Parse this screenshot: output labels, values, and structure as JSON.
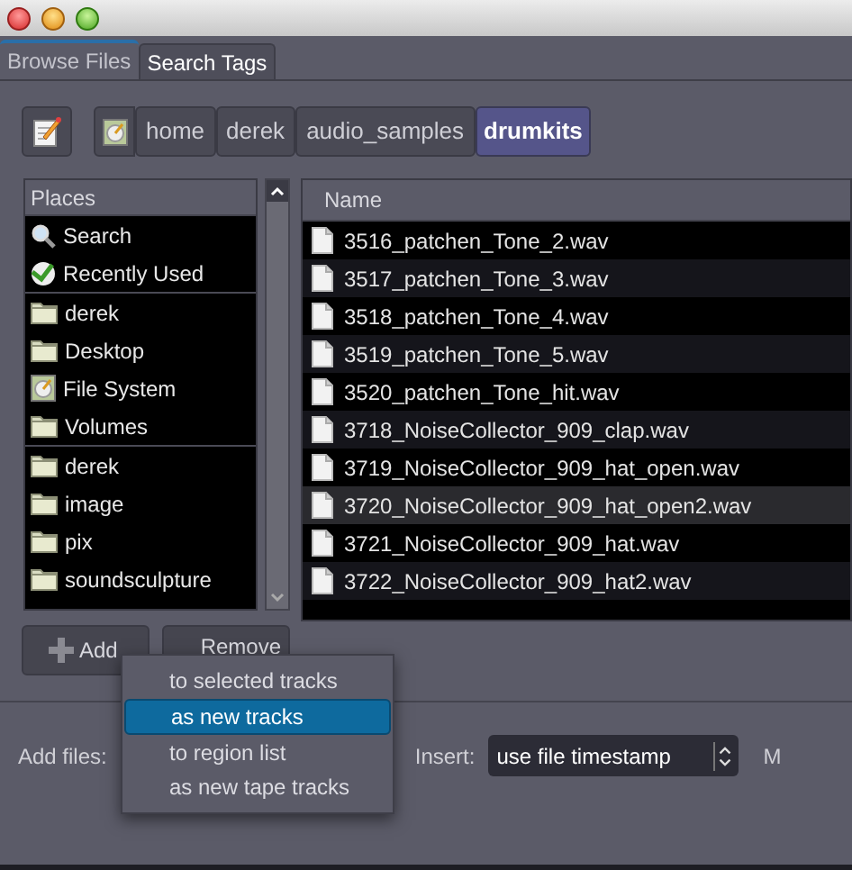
{
  "tabs": [
    {
      "label": "Browse Files",
      "selected": true
    },
    {
      "label": "Search Tags",
      "selected": false
    }
  ],
  "breadcrumb": [
    {
      "label": "home",
      "selected": false
    },
    {
      "label": "derek",
      "selected": false
    },
    {
      "label": "audio_samples",
      "selected": false
    },
    {
      "label": "drumkits",
      "selected": true
    }
  ],
  "places": {
    "title": "Places",
    "groups": [
      [
        {
          "label": "Search",
          "kind": "search"
        },
        {
          "label": "Recently Used",
          "kind": "recent"
        }
      ],
      [
        {
          "label": "derek",
          "kind": "folder"
        },
        {
          "label": "Desktop",
          "kind": "folder"
        },
        {
          "label": "File System",
          "kind": "drive"
        },
        {
          "label": "Volumes",
          "kind": "folder"
        }
      ],
      [
        {
          "label": "derek",
          "kind": "folder"
        },
        {
          "label": "image",
          "kind": "folder"
        },
        {
          "label": "pix",
          "kind": "folder"
        },
        {
          "label": "soundsculpture",
          "kind": "folder"
        }
      ]
    ]
  },
  "files": {
    "column": "Name",
    "rows": [
      {
        "name": "3516_patchen_Tone_2.wav",
        "selected": false
      },
      {
        "name": "3517_patchen_Tone_3.wav",
        "selected": false
      },
      {
        "name": "3518_patchen_Tone_4.wav",
        "selected": false
      },
      {
        "name": "3519_patchen_Tone_5.wav",
        "selected": false
      },
      {
        "name": "3520_patchen_Tone_hit.wav",
        "selected": false
      },
      {
        "name": "3718_NoiseCollector_909_clap.wav",
        "selected": false
      },
      {
        "name": "3719_NoiseCollector_909_hat_open.wav",
        "selected": false
      },
      {
        "name": "3720_NoiseCollector_909_hat_open2.wav",
        "selected": true
      },
      {
        "name": "3721_NoiseCollector_909_hat.wav",
        "selected": false
      },
      {
        "name": "3722_NoiseCollector_909_hat2.wav",
        "selected": false
      }
    ]
  },
  "buttons": {
    "add": "Add",
    "remove": "Remove"
  },
  "add_files_label": "Add files:",
  "insert": {
    "label": "Insert:",
    "value": "use file timestamp"
  },
  "cut_label": "M",
  "popup_menu": [
    {
      "label": "to selected tracks",
      "selected": false
    },
    {
      "label": "as new tracks",
      "selected": true
    },
    {
      "label": "to region list",
      "selected": false
    },
    {
      "label": "as new tape tracks",
      "selected": false
    }
  ]
}
